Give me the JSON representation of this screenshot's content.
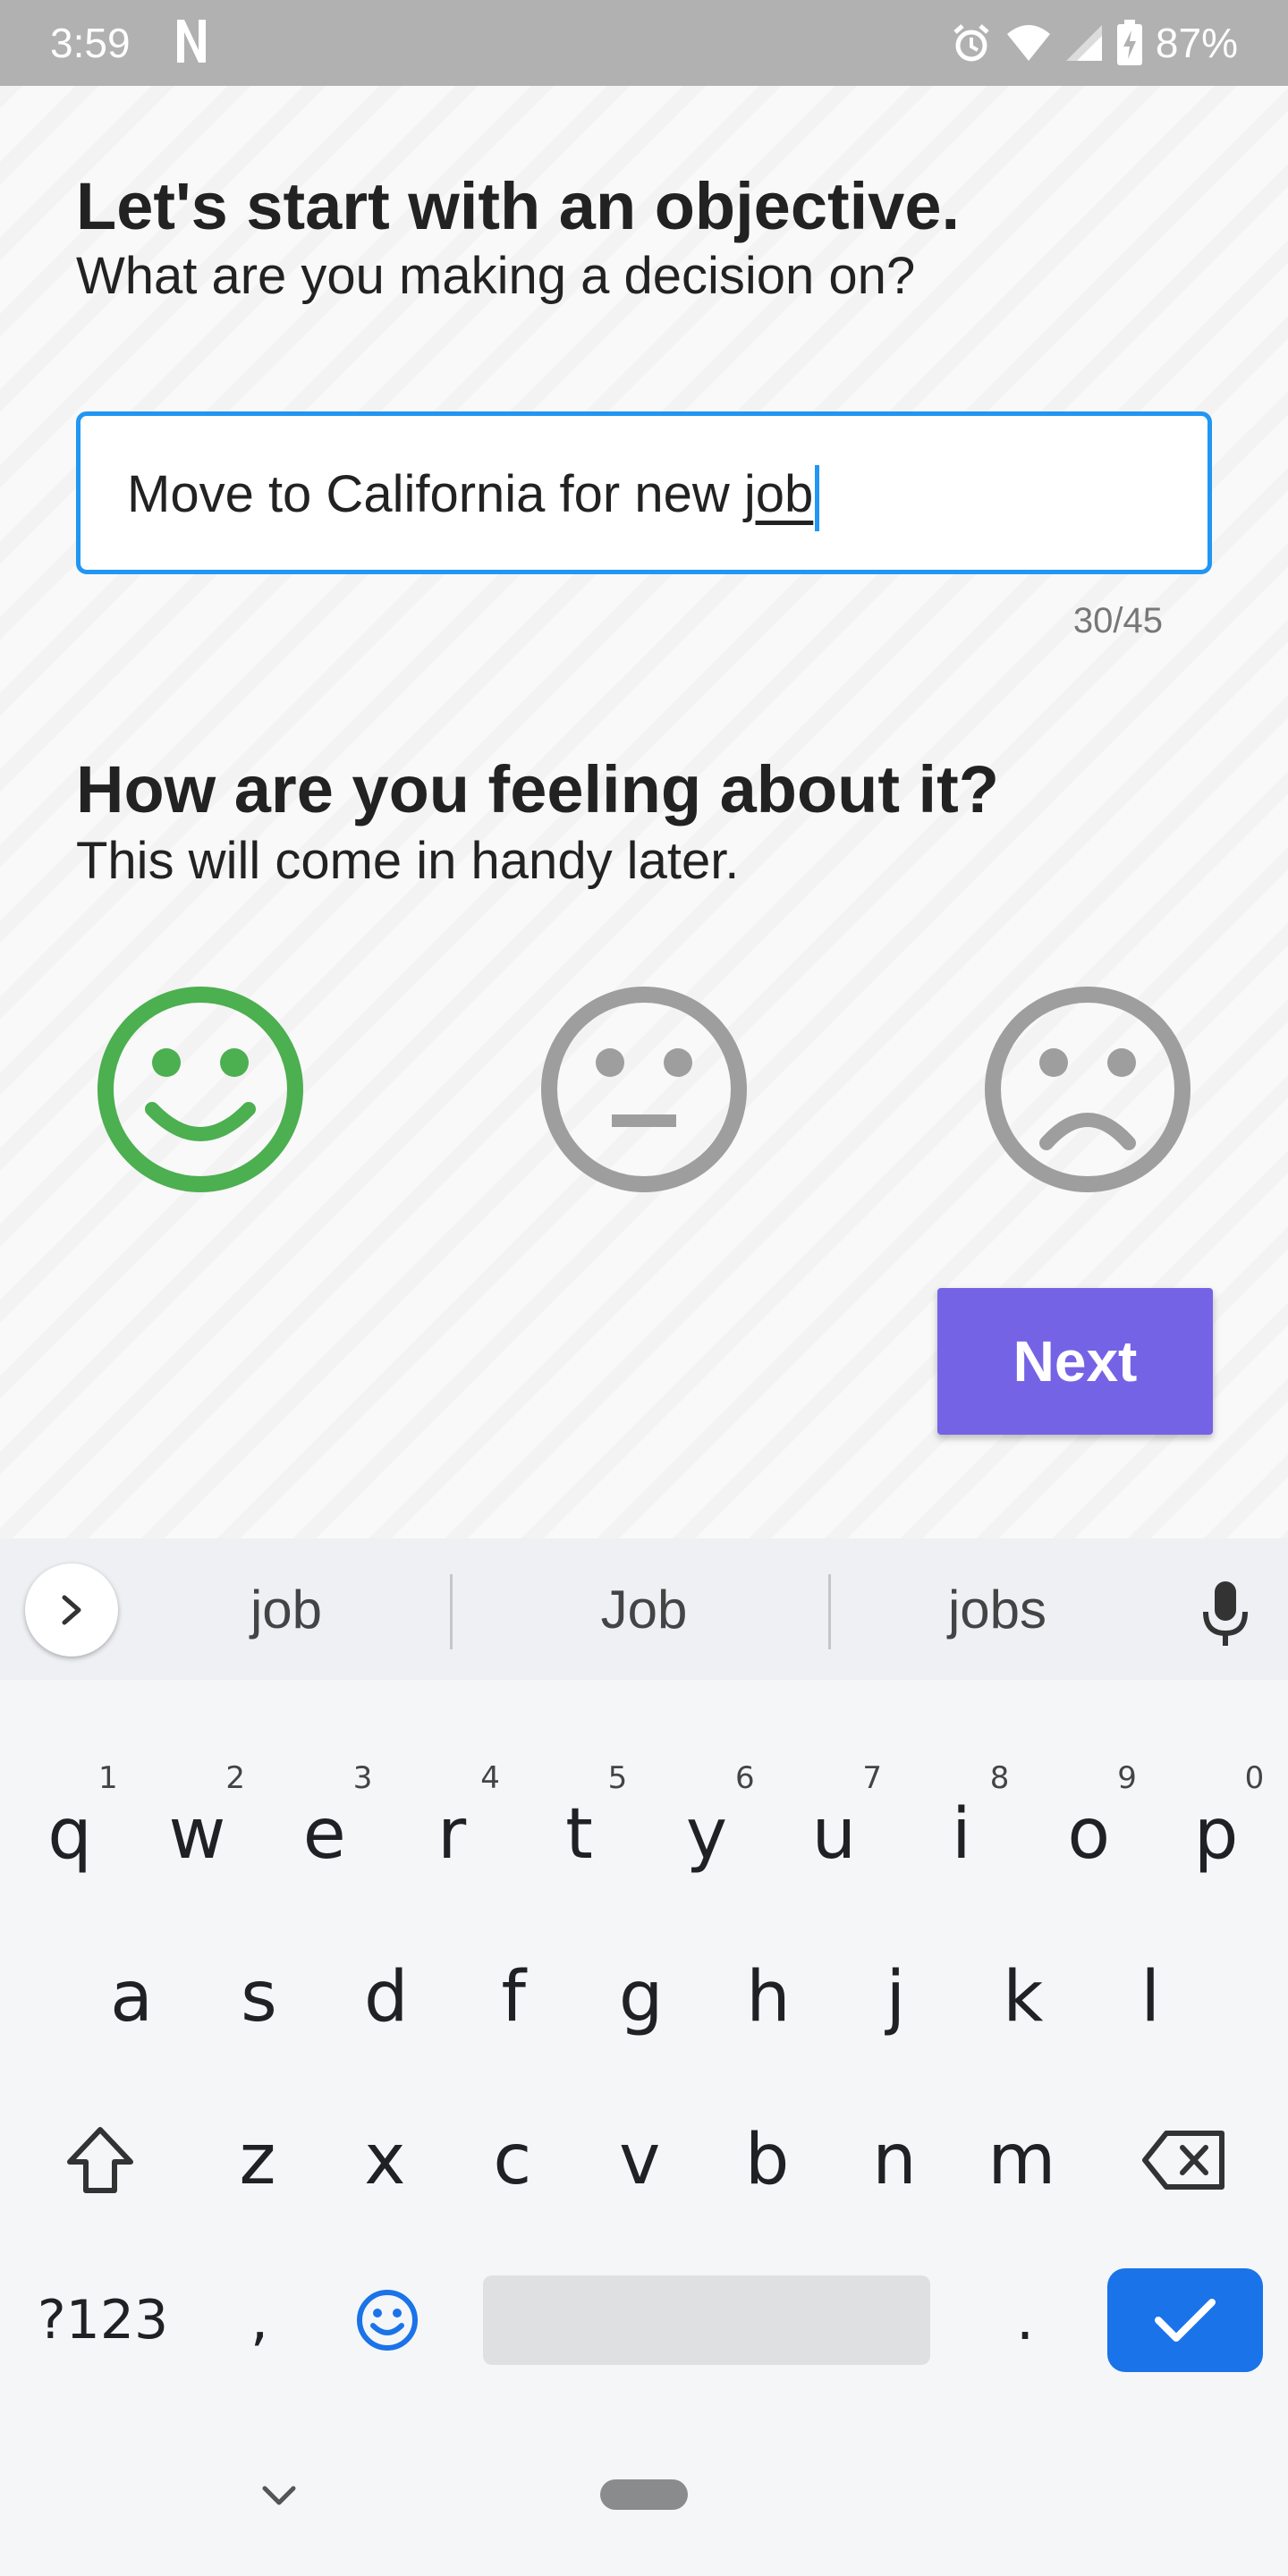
{
  "status_bar": {
    "time": "3:59",
    "battery": "87%"
  },
  "objective": {
    "heading": "Let's start with an objective.",
    "subheading": "What are you making a decision on?",
    "value_prefix": "Move to California for new ",
    "value_composing": "job",
    "char_count": "30/45"
  },
  "feeling": {
    "heading": "How are you feeling about it?",
    "subheading": "This will come in handy later.",
    "options": [
      "happy",
      "neutral",
      "sad"
    ],
    "selected": "happy"
  },
  "next_label": "Next",
  "colors": {
    "accent": "#7563e6",
    "input_border": "#2196f3",
    "happy_selected": "#4caf50",
    "mood_unselected": "#9e9e9e"
  },
  "keyboard": {
    "suggestions": [
      "job",
      "Job",
      "jobs"
    ],
    "row1": [
      "q",
      "w",
      "e",
      "r",
      "t",
      "y",
      "u",
      "i",
      "o",
      "p"
    ],
    "row1_hints": [
      "1",
      "2",
      "3",
      "4",
      "5",
      "6",
      "7",
      "8",
      "9",
      "0"
    ],
    "row2": [
      "a",
      "s",
      "d",
      "f",
      "g",
      "h",
      "j",
      "k",
      "l"
    ],
    "row3": [
      "z",
      "x",
      "c",
      "v",
      "b",
      "n",
      "m"
    ],
    "symbols_label": "?123",
    "comma": ",",
    "period": "."
  }
}
